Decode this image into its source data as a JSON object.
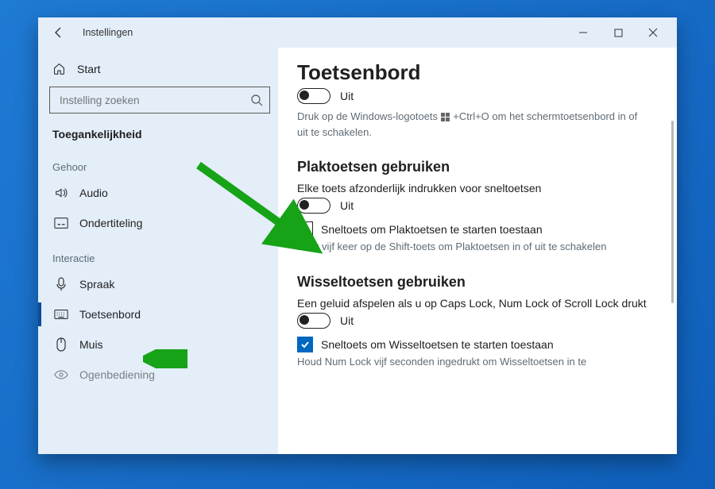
{
  "titlebar": {
    "title": "Instellingen"
  },
  "sidebar": {
    "home": "Start",
    "search_placeholder": "Instelling zoeken",
    "category": "Toegankelijkheid",
    "groups": [
      {
        "label": "Gehoor",
        "items": [
          {
            "key": "audio",
            "label": "Audio"
          },
          {
            "key": "ondertiteling",
            "label": "Ondertiteling"
          }
        ]
      },
      {
        "label": "Interactie",
        "items": [
          {
            "key": "spraak",
            "label": "Spraak"
          },
          {
            "key": "toetsenbord",
            "label": "Toetsenbord",
            "active": true
          },
          {
            "key": "muis",
            "label": "Muis"
          },
          {
            "key": "oogbediening",
            "label": "Ogenbediening"
          }
        ]
      }
    ]
  },
  "main": {
    "title": "Toetsenbord",
    "top_toggle_state": "Uit",
    "top_desc_a": "Druk op de Windows-logotoets ",
    "top_desc_b": " +Ctrl+O om het schermtoetsenbord in of uit te schakelen.",
    "section1": {
      "title": "Plaktoetsen gebruiken",
      "line": "Elke toets afzonderlijk indrukken voor sneltoetsen",
      "toggle_state": "Uit",
      "chk_label": "Sneltoets om Plaktoetsen te starten toestaan",
      "hint": "Druk vijf keer op de Shift-toets om Plaktoetsen in of uit te schakelen"
    },
    "section2": {
      "title": "Wisseltoetsen gebruiken",
      "line": "Een geluid afspelen als u op Caps Lock, Num Lock of Scroll Lock drukt",
      "toggle_state": "Uit",
      "chk_label": "Sneltoets om Wisseltoetsen te starten toestaan",
      "hint": "Houd Num Lock vijf seconden ingedrukt om Wisseltoetsen in te"
    }
  }
}
